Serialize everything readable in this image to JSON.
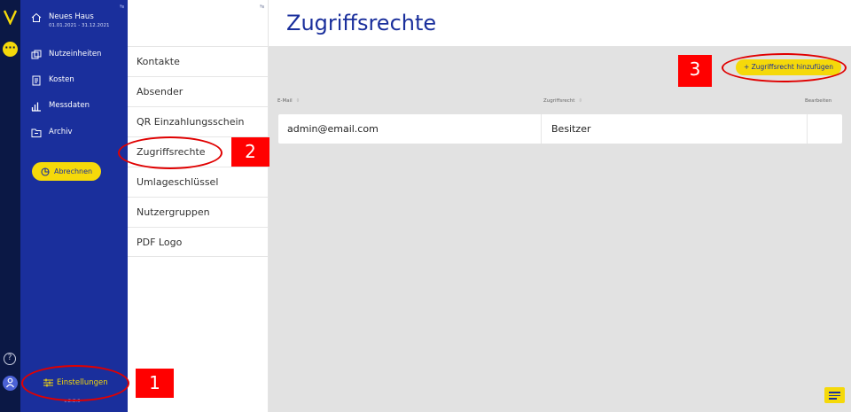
{
  "colors": {
    "rail": "#0b1845",
    "nav_bg": "#1a2f9c",
    "accent_yellow": "#f5d90a",
    "title_blue": "#1a2f9c",
    "content_bg": "#e2e2e2",
    "annotation_red": "#ff0000"
  },
  "rail": {
    "logo_icon": "v-logo-icon",
    "menu_icon": "more-dots-icon",
    "menu_label": "···",
    "help_icon": "help-circle-icon",
    "help_label": "?",
    "user_icon": "user-icon"
  },
  "nav": {
    "property": {
      "name": "Neues Haus",
      "period": "01.01.2021 - 31.12.2021",
      "icon": "home-icon"
    },
    "items": [
      {
        "label": "Nutzeinheiten",
        "icon": "units-icon"
      },
      {
        "label": "Kosten",
        "icon": "receipt-icon"
      },
      {
        "label": "Messdaten",
        "icon": "bar-chart-icon"
      },
      {
        "label": "Archiv",
        "icon": "archive-icon"
      }
    ],
    "abrechnen": "Abrechnen",
    "einstellungen": "Einstellungen",
    "version": "v.2.8.0"
  },
  "submenu": {
    "items": [
      "Kontakte",
      "Absender",
      "QR Einzahlungsschein",
      "Zugriffsrechte",
      "Umlageschlüssel",
      "Nutzergruppen",
      "PDF Logo"
    ]
  },
  "main": {
    "title": "Zugriffsrechte",
    "add_button": "+ Zugriffsrecht hinzufügen",
    "table": {
      "headers": [
        "E-Mail",
        "Zugriffsrecht",
        "Bearbeiten"
      ],
      "rows": [
        {
          "email": "admin@email.com",
          "role": "Besitzer"
        }
      ]
    }
  },
  "annotations": [
    "1",
    "2",
    "3"
  ]
}
